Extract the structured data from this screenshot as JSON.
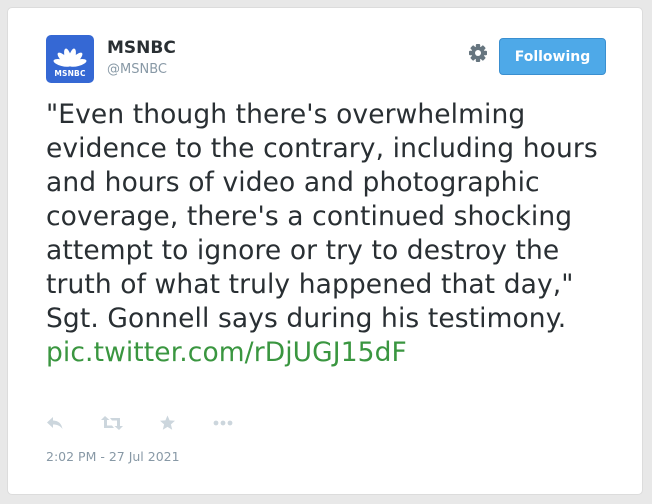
{
  "account": {
    "name": "MSNBC",
    "handle": "@MSNBC",
    "avatar_label": "MSNBC",
    "avatar_color": "#3568d4"
  },
  "follow_button": {
    "label": "Following",
    "color": "#4ea9e8"
  },
  "tweet": {
    "text": "\"Even though there's overwhelming evidence to the contrary, including hours and hours of video and photographic coverage, there's a continued shocking attempt to ignore or try to destroy the truth of what truly happened that day,\" Sgt. Gonnell says during his testimony.",
    "link": "pic.twitter.com/rDjUGJ15dF",
    "link_color": "#3a9640"
  },
  "actions": [
    "reply-icon",
    "retweet-icon",
    "favorite-icon",
    "more-icon"
  ],
  "icons": {
    "settings": "gear-icon"
  },
  "timestamp": "2:02 PM - 27 Jul 2021"
}
